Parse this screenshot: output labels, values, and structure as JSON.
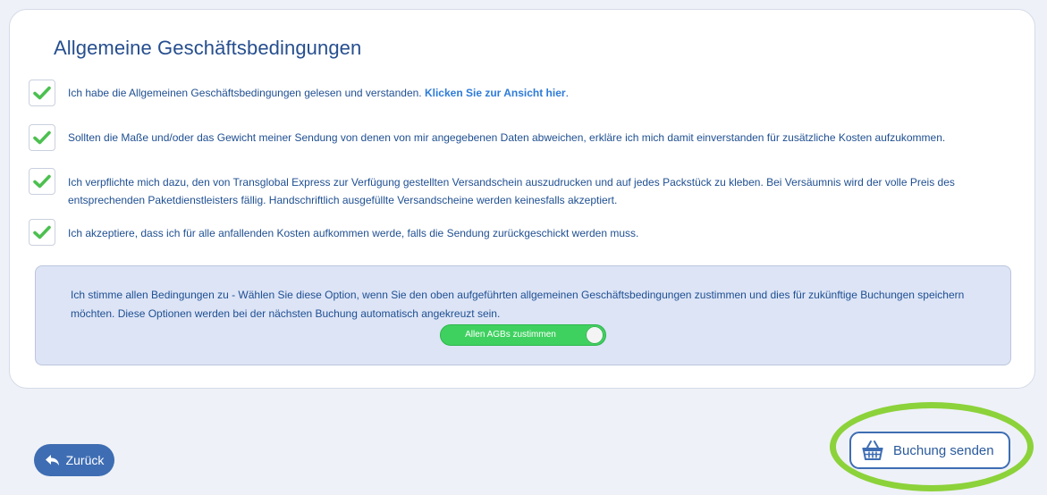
{
  "page": {
    "title": "Allgemeine Geschäftsbedingungen"
  },
  "terms": [
    {
      "text": "Ich habe die Allgemeinen Geschäftsbedingungen gelesen und verstanden. ",
      "link": "Klicken Sie zur Ansicht hier",
      "suffix": ".",
      "checked": true
    },
    {
      "text": "Sollten die Maße und/oder das Gewicht meiner Sendung von denen von mir angegebenen Daten abweichen, erkläre ich mich damit einverstanden für zusätzliche Kosten aufzukommen.",
      "checked": true
    },
    {
      "text": "Ich verpflichte mich dazu, den von Transglobal Express zur Verfügung gestellten Versandschein auszudrucken und auf jedes Packstück zu kleben. Bei Versäumnis wird der volle Preis des entsprechenden Paketdienstleisters fällig. Handschriftlich ausgefüllte Versandscheine werden keinesfalls akzeptiert.",
      "checked": true
    },
    {
      "text": "Ich akzeptiere, dass ich für alle anfallenden Kosten aufkommen werde, falls die Sendung zurückgeschickt werden muss.",
      "checked": true
    }
  ],
  "consent": {
    "text": "Ich stimme allen Bedingungen zu - Wählen Sie diese Option, wenn Sie den oben aufgeführten allgemeinen Geschäftsbedingungen zustimmen und dies für zukünftige Buchungen speichern möchten. Diese Optionen werden bei der nächsten Buchung automatisch angekreuzt sein.",
    "toggle_label": "Allen AGBs zustimmen",
    "toggle_on": true
  },
  "actions": {
    "back_label": "Zurück",
    "submit_label": "Buchung senden",
    "back_icon": "reply-arrow-icon",
    "submit_icon": "shopping-basket-icon"
  },
  "colors": {
    "accent": "#3e6db3",
    "check": "#4cc04f",
    "toggle": "#3fd160",
    "highlight": "#8cd23a"
  }
}
